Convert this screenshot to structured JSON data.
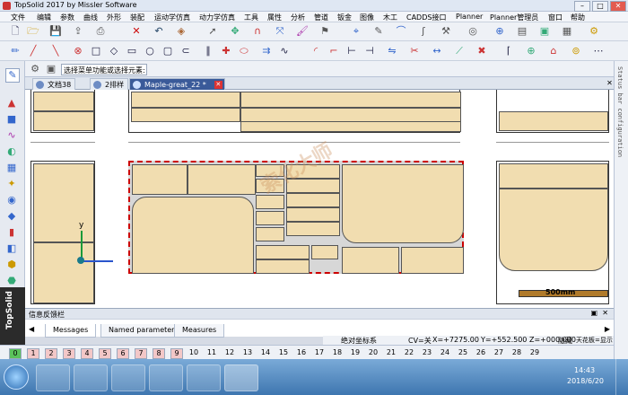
{
  "window": {
    "title": "TopSolid 2017 by Missler Software",
    "min": "–",
    "max": "□",
    "close": "✕"
  },
  "menu": [
    "文件",
    "编辑",
    "参数",
    "曲线",
    "外形",
    "装配",
    "运动学仿真",
    "动力学仿真",
    "工具",
    "属性",
    "分析",
    "管道",
    "钣金",
    "图像",
    "木工",
    "CADDS接口",
    "Planner",
    "Planner管理员",
    "窗口",
    "帮助"
  ],
  "command": {
    "placeholder": "选择菜单功能或选择元素:",
    "value": ""
  },
  "tabs": [
    {
      "label": "文档38",
      "active": false
    },
    {
      "label": "2排样",
      "active": false
    },
    {
      "label": "Maple-great_22 *",
      "active": true
    }
  ],
  "canvas": {
    "scale_label": "500mm",
    "axis_y": "y",
    "watermark": "索化大师",
    "accent_selection": "#cc0000",
    "panel_color": "#f1ddb0"
  },
  "right_panel_label": "Status bar configuration",
  "brand_label": "TopSolid",
  "feedback": {
    "title": "信息反馈栏",
    "tabs": [
      "Messages",
      "Named parameters",
      "Measures"
    ]
  },
  "status": {
    "fkeys": [
      "0",
      "1",
      "2",
      "3",
      "4",
      "5",
      "6",
      "7",
      "8",
      "9",
      "10",
      "11",
      "12",
      "13",
      "14",
      "15",
      "16",
      "17",
      "18",
      "19",
      "20",
      "21",
      "22",
      "23",
      "24",
      "25",
      "26",
      "27",
      "28",
      "29"
    ],
    "coord_mode": "绝对坐标系",
    "cv": "CV=关",
    "x": "X=+7275.00",
    "y": "Y=+552.500",
    "z": "Z=+000.000",
    "hide": "隐藏",
    "ceiling": "天花板=显示"
  },
  "taskbar": {
    "time": "14:43",
    "date": "2018/6/20"
  }
}
